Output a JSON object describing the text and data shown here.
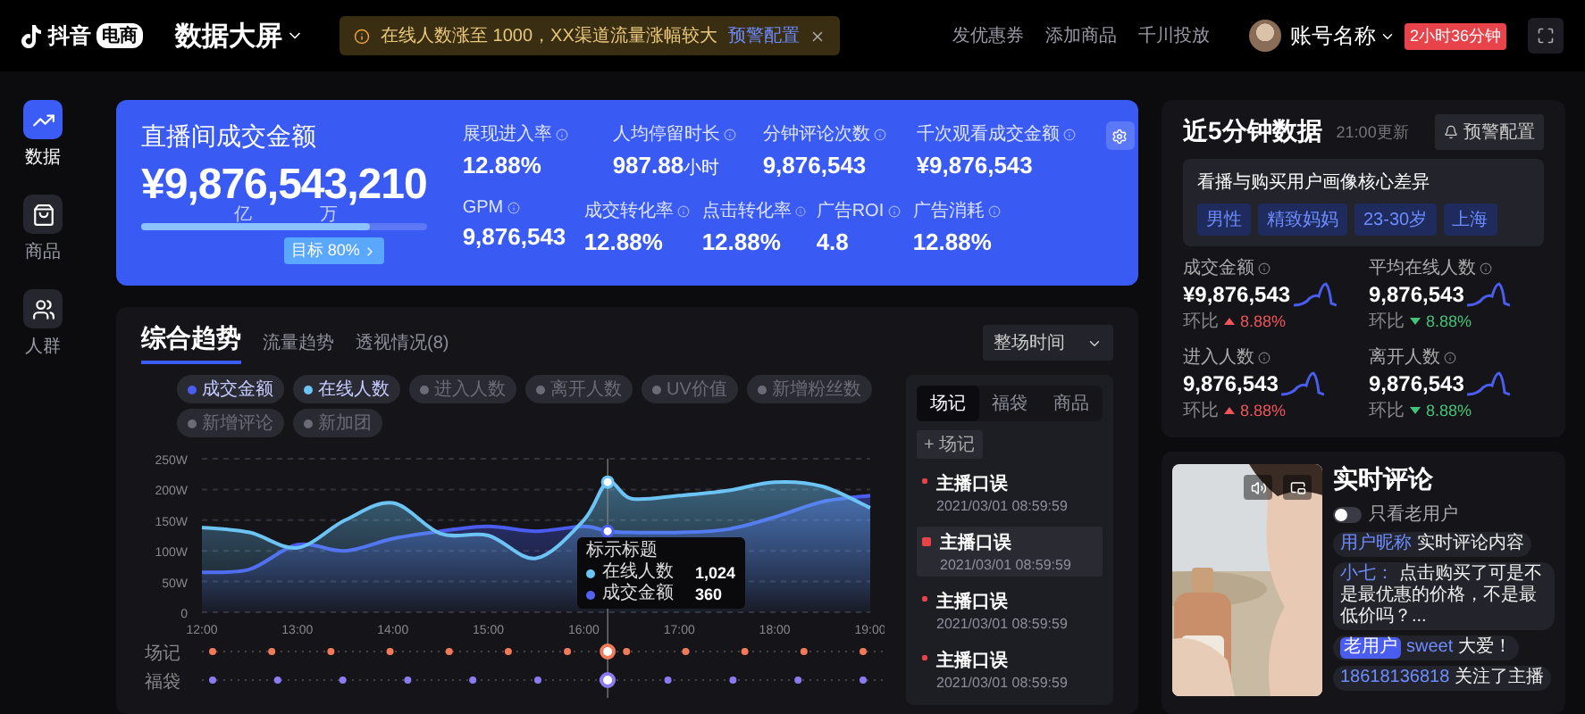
{
  "topbar": {
    "logo_text": "抖音",
    "logo_badge": "电商",
    "title": "数据大屏",
    "notice": {
      "text": "在线人数涨至 1000，XX渠道流量涨幅较大",
      "link": "预警配置"
    },
    "links": [
      "发优惠券",
      "添加商品",
      "千川投放"
    ],
    "account": "账号名称",
    "countdown": "2小时36分钟"
  },
  "sidebar": {
    "items": [
      {
        "label": "数据",
        "selected": true,
        "kind": "chart"
      },
      {
        "label": "商品",
        "selected": false,
        "kind": "bag"
      },
      {
        "label": "人群",
        "selected": false,
        "kind": "people"
      }
    ]
  },
  "summary": {
    "title": "直播间成交金额",
    "amount": "¥9,876,543,210",
    "digit_marks": [
      "亿",
      "万"
    ],
    "level": 0.8,
    "target": "目标 80%",
    "metric_rows": [
      [
        {
          "label": "展现进入率",
          "value": "12.88%"
        },
        {
          "label": "人均停留时长",
          "value": "987.88",
          "unit": "小时"
        },
        {
          "label": "分钟评论次数",
          "value": "9,876,543"
        },
        {
          "label": "千次观看成交金额",
          "value": "¥9,876,543"
        }
      ],
      [
        {
          "label": "GPM",
          "value": "9,876,543"
        },
        {
          "label": "成交转化率",
          "value": "12.88%"
        },
        {
          "label": "点击转化率",
          "value": "12.88%"
        },
        {
          "label": "广告ROI",
          "value": "4.8"
        },
        {
          "label": "广告消耗",
          "value": "12.88%"
        }
      ]
    ]
  },
  "trend": {
    "tabs": [
      {
        "label": "综合趋势",
        "selected": true
      },
      {
        "label": "流量趋势",
        "selected": false
      },
      {
        "label": "透视情况(8)",
        "selected": false
      }
    ],
    "chips": [
      {
        "label": "进入人数",
        "on": false,
        "color": "#6b6b78"
      },
      {
        "label": "离开人数",
        "on": false,
        "color": "#6b6b78"
      },
      {
        "label": "UV价值",
        "on": false,
        "color": "#6b6b78"
      },
      {
        "label": "新增粉丝数",
        "on": false,
        "color": "#6b6b78"
      },
      {
        "label": "新增评论",
        "on": false,
        "color": "#6b6b78"
      },
      {
        "label": "新加团",
        "on": false,
        "color": "#6b6b78"
      }
    ],
    "range": "整场时间",
    "chart_data": {
      "type": "area",
      "x": [
        12,
        12.5,
        13,
        13.5,
        14,
        14.5,
        15,
        15.5,
        16,
        16.25,
        16.5,
        17,
        17.5,
        18,
        18.5,
        19
      ],
      "series": [
        {
          "name": "成交金额",
          "color": "#4a5df0",
          "values": [
            65,
            70,
            110,
            100,
            120,
            132,
            140,
            132,
            140,
            132,
            130,
            130,
            135,
            155,
            180,
            190
          ]
        },
        {
          "name": "在线人数",
          "color": "#6cc4f5",
          "values": [
            138,
            130,
            105,
            150,
            178,
            128,
            125,
            88,
            150,
            212,
            185,
            190,
            198,
            212,
            205,
            170
          ]
        }
      ],
      "grid": true,
      "xlim": [
        12,
        19
      ],
      "ylim": [
        0,
        250
      ],
      "xticks": [
        {
          "value": 12,
          "label": "12:00"
        },
        {
          "value": 13,
          "label": "13:00"
        },
        {
          "value": 14,
          "label": "14:00"
        },
        {
          "value": 15,
          "label": "15:00"
        },
        {
          "value": 16,
          "label": "16:00"
        },
        {
          "value": 17,
          "label": "17:00"
        },
        {
          "value": 18,
          "label": "18:00"
        },
        {
          "value": 19,
          "label": "19:00"
        }
      ],
      "yticks": [
        {
          "value": 0,
          "label": "0"
        },
        {
          "value": 50,
          "label": "50W"
        },
        {
          "value": 100,
          "label": "100W"
        },
        {
          "value": 150,
          "label": "150W"
        },
        {
          "value": 200,
          "label": "200W"
        },
        {
          "value": 250,
          "label": "250W"
        }
      ],
      "ref_lines": [
        {
          "axis": "x",
          "value": 16.25
        }
      ]
    },
    "tooltip": {
      "title": "标示标题",
      "rows": [
        {
          "label": "在线人数",
          "value": "1,024",
          "color": "#6cc4f5"
        },
        {
          "label": "成交金额",
          "value": "360",
          "color": "#5563f2"
        }
      ]
    },
    "event_rows": [
      {
        "label": "场记",
        "color": "#f07a5a"
      },
      {
        "label": "福袋",
        "color": "#8a7cf0"
      }
    ],
    "log": {
      "tabs": [
        {
          "label": "场记",
          "selected": true
        },
        {
          "label": "福袋",
          "selected": false
        },
        {
          "label": "商品",
          "selected": false
        }
      ],
      "add": "+ 场记",
      "items": [
        {
          "title": "主播口误",
          "time": "2021/03/01 08:59:59",
          "selected": false
        },
        {
          "title": "主播口误",
          "time": "2021/03/01 08:59:59",
          "selected": true
        },
        {
          "title": "主播口误",
          "time": "2021/03/01 08:59:59",
          "selected": false
        },
        {
          "title": "主播口误",
          "time": "2021/03/01 08:59:59",
          "selected": false
        }
      ]
    }
  },
  "recent": {
    "title": "近5分钟数据",
    "updated": "21:00更新",
    "button": "预警配置",
    "profile": {
      "title": "看播与购买用户画像核心差异",
      "tags": [
        "男性",
        "精致妈妈",
        "23-30岁",
        "上海"
      ]
    },
    "stats": [
      {
        "label": "成交金额",
        "value": "¥9,876,543",
        "compare": "环比",
        "change": "8.88%",
        "rising": true
      },
      {
        "label": "平均在线人数",
        "value": "9,876,543",
        "compare": "环比",
        "change": "8.88%",
        "rising": false
      },
      {
        "label": "进入人数",
        "value": "9,876,543",
        "compare": "环比",
        "change": "8.88%",
        "rising": true
      },
      {
        "label": "离开人数",
        "value": "9,876,543",
        "compare": "环比",
        "change": "8.88%",
        "rising": false
      }
    ]
  },
  "live": {
    "title": "实时评论",
    "toggle": {
      "label": "只看老用户",
      "on": false
    },
    "comments": [
      {
        "name": "用户昵称",
        "text": "实时评论内容"
      },
      {
        "name": "小七：",
        "text": "点击购买了可是不是最优惠的价格，不是最低价吗？..."
      },
      {
        "badge": "老用户",
        "name": "sweet",
        "text": "大爱！"
      },
      {
        "name": "18618136818",
        "text": "关注了主播"
      }
    ]
  }
}
